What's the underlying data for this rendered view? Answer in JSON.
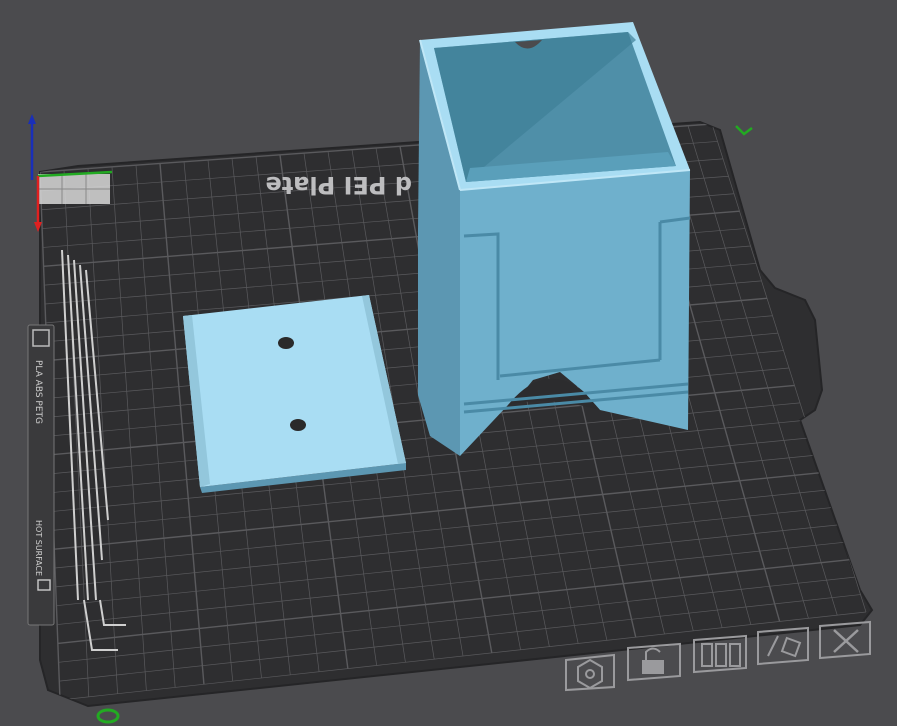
{
  "plate": {
    "label": "d PEI Plate",
    "side_labels": [
      "PLA ABS PETG",
      "HOT SURFACE"
    ]
  },
  "axes": {
    "x_color": "#e02020",
    "y_color": "#22aa22",
    "z_color": "#1a2fb8"
  },
  "colors": {
    "background": "#4b4b4e",
    "bed": "#2e2e30",
    "grid": "#5a5a5d",
    "model_top": "#a9ddf3",
    "model_front": "#6fb0cc",
    "model_side": "#5c97b2",
    "toolbar_icon": "#9a9a9d"
  },
  "toolbar": [
    {
      "name": "arrange-button",
      "icon": "hexagon-nut-icon"
    },
    {
      "name": "lock-button",
      "icon": "lock-icon"
    },
    {
      "name": "layout-button",
      "icon": "layout-columns-icon"
    },
    {
      "name": "paint-button",
      "icon": "brush-icon"
    },
    {
      "name": "delete-button",
      "icon": "close-icon"
    }
  ]
}
